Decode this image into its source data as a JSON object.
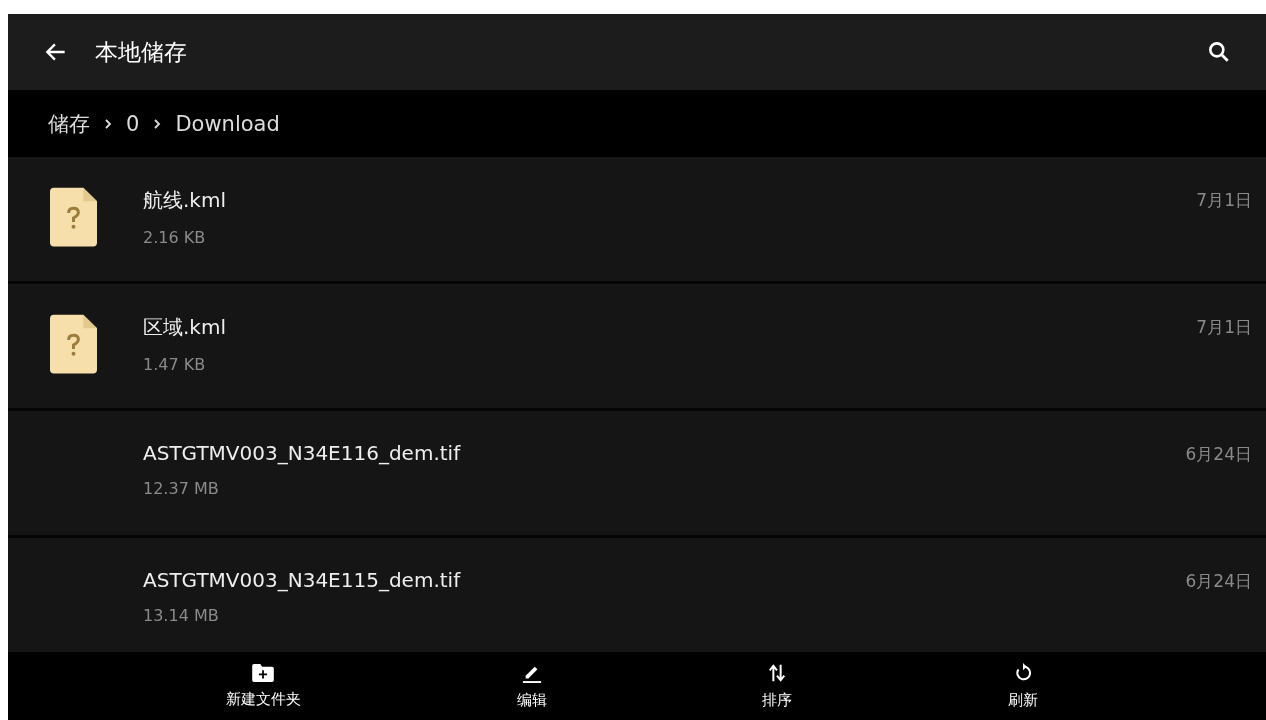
{
  "header": {
    "title": "本地储存"
  },
  "breadcrumb": [
    {
      "label": "储存"
    },
    {
      "label": "0"
    },
    {
      "label": "Download"
    }
  ],
  "files": [
    {
      "name": "航线.kml",
      "size": "2.16 KB",
      "date": "7月1日",
      "kind": "unknown"
    },
    {
      "name": "区域.kml",
      "size": "1.47 KB",
      "date": "7月1日",
      "kind": "unknown"
    },
    {
      "name": "ASTGTMV003_N34E116_dem.tif",
      "size": "12.37 MB",
      "date": "6月24日",
      "kind": "plain"
    },
    {
      "name": "ASTGTMV003_N34E115_dem.tif",
      "size": "13.14 MB",
      "date": "6月24日",
      "kind": "plain"
    }
  ],
  "toolbar": [
    {
      "label": "新建文件夹",
      "kind": "new-folder"
    },
    {
      "label": "编辑",
      "kind": "edit"
    },
    {
      "label": "排序",
      "kind": "sort"
    },
    {
      "label": "刷新",
      "kind": "refresh"
    }
  ]
}
